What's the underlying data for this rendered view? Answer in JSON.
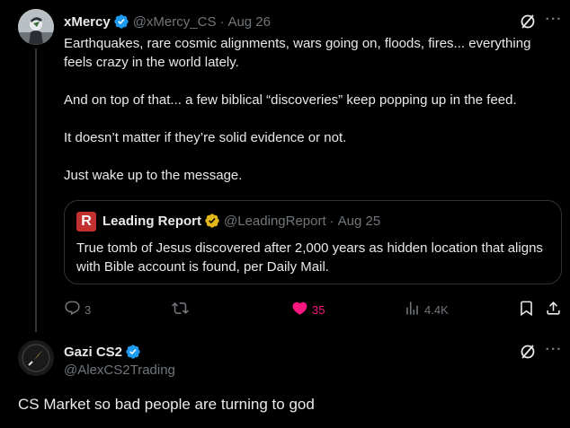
{
  "post1": {
    "author_name": "xMercy",
    "handle": "@xMercy_CS",
    "dot": "·",
    "date": "Aug 26",
    "paragraphs": [
      "Earthquakes, rare cosmic alignments, wars going on, floods, fires... everything feels crazy in the world lately.",
      "And on top of that... a few biblical “discoveries” keep popping up in the feed.",
      "It doesn’t matter if they’re solid evidence or not.",
      "Just wake up to the message."
    ],
    "quote": {
      "logo_letter": "R",
      "author_name": "Leading Report",
      "handle": "@LeadingReport",
      "dot": "·",
      "date": "Aug 25",
      "text": "True tomb of Jesus discovered after 2,000 years as hidden location that aligns with Bible account is found, per Daily Mail."
    },
    "actions": {
      "replies": "3",
      "reposts": "",
      "likes": "35",
      "views": "4.4K"
    }
  },
  "post2": {
    "author_name": "Gazi CS2",
    "handle": "@AlexCS2Trading",
    "text": "CS Market so bad people are turning to god"
  },
  "colors": {
    "background": "#000000",
    "text": "#e7e9ea",
    "muted": "#71767b",
    "verified_blue": "#1d9bf0",
    "verified_gold": "#e2b719",
    "like_pink": "#f91880",
    "border": "#2f3336"
  },
  "icons": [
    "verified-badge-icon",
    "grok-icon",
    "more-icon",
    "reply-icon",
    "repost-icon",
    "like-icon",
    "views-icon",
    "bookmark-icon",
    "share-icon"
  ]
}
